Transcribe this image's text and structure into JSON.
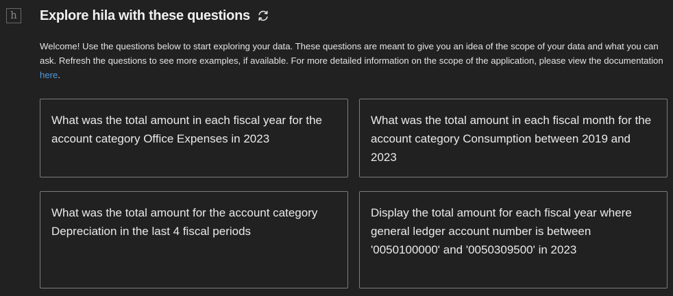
{
  "app": {
    "logo_letter": "h"
  },
  "header": {
    "title": "Explore hila with these questions",
    "refresh_icon": "refresh-icon"
  },
  "intro": {
    "text": "Welcome! Use the questions below to start exploring your data. These questions are meant to give you an idea of the scope of your data and what you can ask. Refresh the questions to see more examples, if available. For more detailed information on the scope of the application, please view the documentation ",
    "link_text": "here",
    "trailing": ".",
    "link_color": "#4d9be6"
  },
  "questions": [
    "What was the total amount in each fiscal year for the account category Office Expenses in 2023",
    "What was the total amount in each fiscal month for the account category Consumption between 2019 and 2023",
    "What was the total amount for the account category Depreciation in the last 4 fiscal periods",
    "Display the total amount for each fiscal year where general ledger account number is between '0050100000' and '0050309500' in 2023"
  ]
}
